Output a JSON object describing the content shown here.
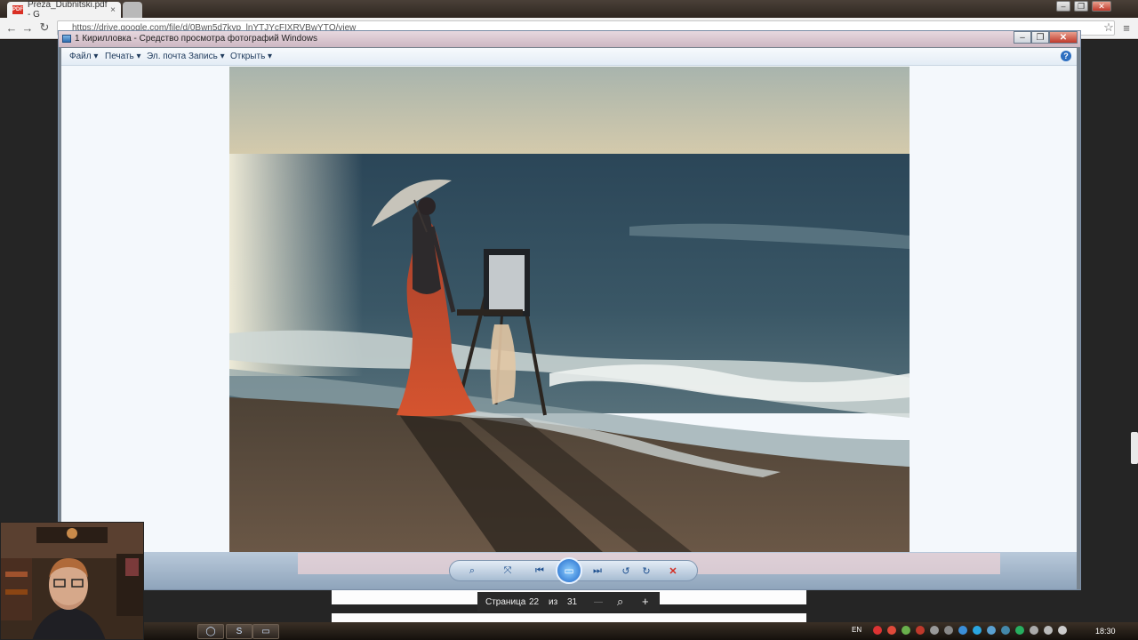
{
  "browser": {
    "active_tab": "Preza_Dubnitski.pdf - G",
    "pdf_badge": "PDF",
    "url": "https://drive.google.com/file/d/0Bwn5d7kvp_lnYTJYcFIXRVBwYTQ/view",
    "window_buttons": [
      "–",
      "❐",
      "✕"
    ]
  },
  "viewer": {
    "title": "1 Кирилловка - Средство просмотра фотографий Windows",
    "menu": [
      "Файл ▾",
      "Печать ▾",
      "Эл. почта",
      "Запись ▾",
      "Открыть ▾"
    ],
    "help": "?",
    "caption_buttons": [
      "–",
      "❐",
      "✕"
    ],
    "controls": {
      "zoom": "⌕",
      "fit": "⤧",
      "prev": "⏮",
      "slideshow": "▭",
      "next": "⏭",
      "rotate_left": "↺",
      "rotate_right": "↻",
      "delete": "✕"
    }
  },
  "pdf_bar": {
    "page_label": "Страница",
    "current_page": "22",
    "of_label": "из",
    "total_pages": "31",
    "minus": "—",
    "zoom_icon": "⌕",
    "plus": "+"
  },
  "taskbar": {
    "lang": "EN",
    "clock": "18:30"
  },
  "colors": {
    "sky_top": "#a9b5ad",
    "sky_horizon": "#d9ccaa",
    "sea": "#2c4a5a",
    "sand": "#5a4938",
    "dress": "#c84a2c",
    "viewer_accent": "#1d66c9"
  }
}
